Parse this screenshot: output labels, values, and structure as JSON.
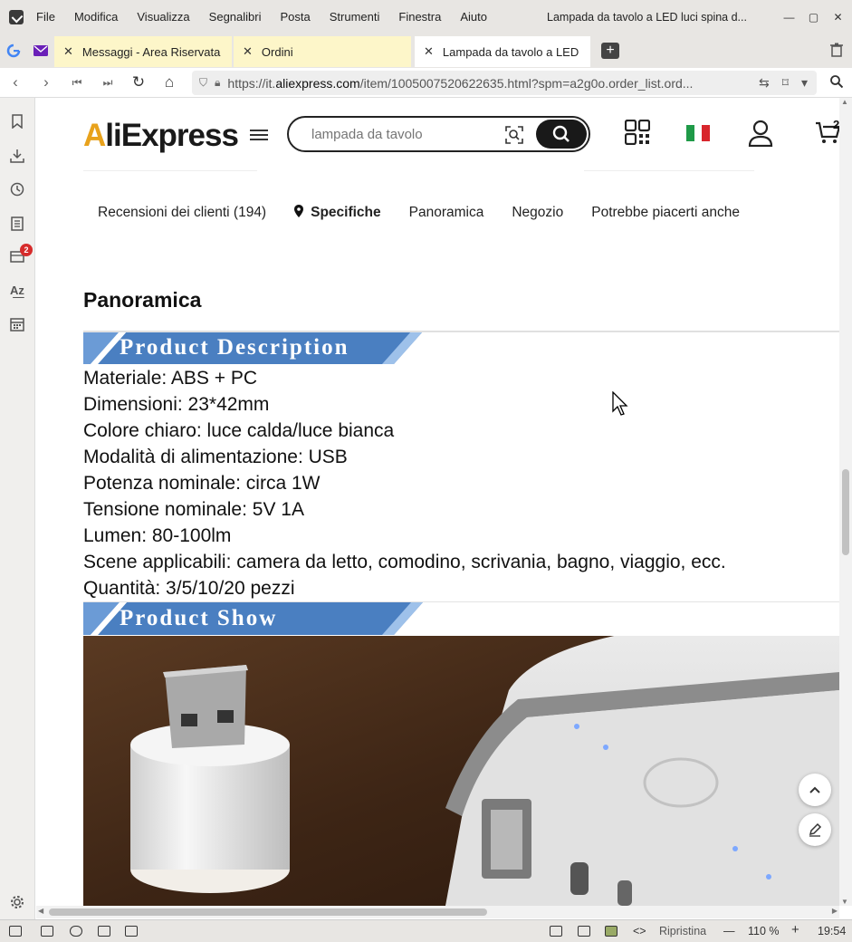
{
  "menubar": {
    "items": [
      "File",
      "Modifica",
      "Visualizza",
      "Segnalibri",
      "Posta",
      "Strumenti",
      "Finestra",
      "Aiuto"
    ],
    "window_title": "Lampada da tavolo a LED luci spina d..."
  },
  "tabs": [
    {
      "label": "Messaggi - Area Riservata"
    },
    {
      "label": "Ordini"
    },
    {
      "label": "Lampada da tavolo a LED l"
    }
  ],
  "address": {
    "url_prefix": "https://it.",
    "url_domain": "aliexpress.com",
    "url_rest": "/item/1005007520622635.html?spm=a2g0o.order_list.ord..."
  },
  "sidebar": {
    "badge_count": "2"
  },
  "site": {
    "logo_a": "A",
    "logo_rest": "liExpress",
    "search_placeholder": "lampada da tavolo",
    "cart_count": "2",
    "anchor_nav": [
      "Recensioni dei clienti (194)",
      "Specifiche",
      "Panoramica",
      "Negozio",
      "Potrebbe piacerti anche"
    ],
    "section_title": "Panoramica",
    "banner1": "Product  Description",
    "banner2": "Product  Show",
    "specs": [
      "Materiale: ABS + PC",
      "Dimensioni: 23*42mm",
      "Colore chiaro: luce calda/luce bianca",
      "Modalità di alimentazione: USB",
      "Potenza nominale: circa 1W",
      "Tensione nominale: 5V 1A",
      "Lumen: 80-100lm",
      "Scene applicabili: camera da letto, comodino, scrivania, bagno, viaggio, ecc.",
      "Quantità: 3/5/10/20 pezzi"
    ]
  },
  "statusbar": {
    "restore_label": "Ripristina",
    "zoom": "110 %",
    "time": "19:54"
  },
  "colors": {
    "banner_blue": "#4a7fc1",
    "logo_accent": "#e8a21c",
    "badge_red": "#d62b2b"
  }
}
